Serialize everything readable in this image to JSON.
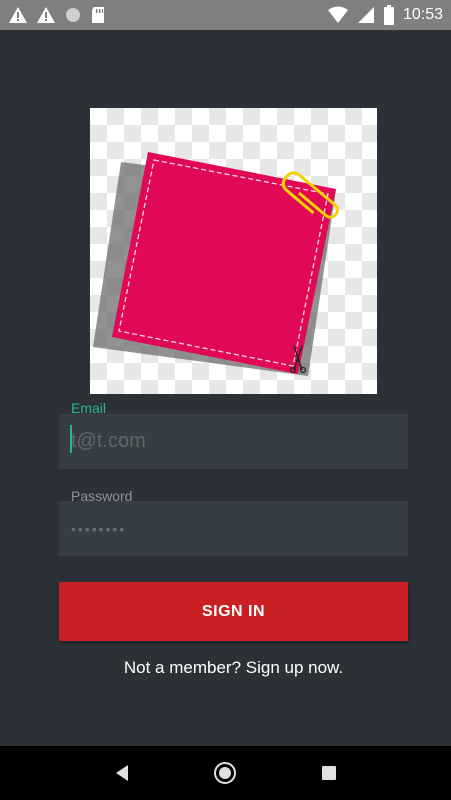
{
  "status_bar": {
    "time": "10:53",
    "icons": [
      "warning-icon",
      "warning-icon",
      "circle-icon",
      "sd-card-icon",
      "wifi-icon",
      "signal-icon",
      "battery-icon"
    ]
  },
  "form": {
    "email_label": "Email",
    "email_placeholder": "t@t.com",
    "password_label": "Password",
    "password_placeholder": "••••••••"
  },
  "button": {
    "sign_in": "SIGN IN"
  },
  "footer": {
    "signup_text": "Not a member? Sign up now."
  },
  "nav_bar": {
    "icons": [
      "back-icon",
      "home-icon",
      "recents-icon"
    ]
  },
  "colors": {
    "background": "#2b3136",
    "accent": "#2bb39a",
    "button": "#ca1f23",
    "note": "#e10855"
  }
}
